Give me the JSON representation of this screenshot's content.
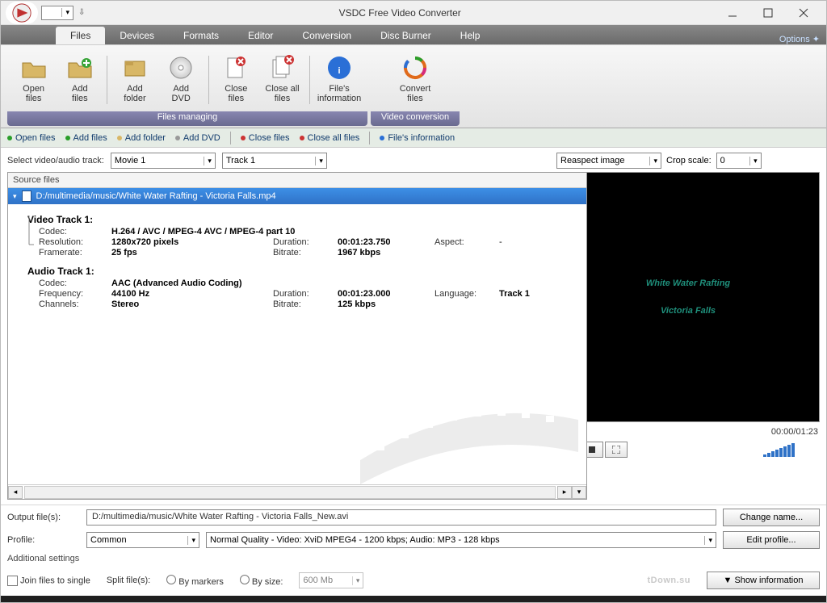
{
  "window": {
    "title": "VSDC Free Video Converter",
    "tabs": [
      "Files",
      "Devices",
      "Formats",
      "Editor",
      "Conversion",
      "Disc Burner",
      "Help"
    ],
    "active_tab": "Files",
    "options": "Options"
  },
  "ribbon": {
    "group1_label": "Files managing",
    "group2_label": "Video conversion",
    "buttons": {
      "open": "Open\nfiles",
      "add": "Add\nfiles",
      "add_folder": "Add\nfolder",
      "add_dvd": "Add\nDVD",
      "close": "Close\nfiles",
      "close_all": "Close all\nfiles",
      "info": "File's\ninformation",
      "convert": "Convert\nfiles"
    }
  },
  "toolbar2": {
    "open": "Open files",
    "add": "Add files",
    "add_folder": "Add folder",
    "add_dvd": "Add DVD",
    "close": "Close files",
    "close_all": "Close all files",
    "info": "File's information"
  },
  "selectors": {
    "label": "Select video/audio track:",
    "movie": "Movie 1",
    "track": "Track 1"
  },
  "source": {
    "panel_title": "Source files",
    "file_path": "D:/multimedia/music/White Water Rafting - Victoria Falls.mp4",
    "video_track_title": "Video Track 1:",
    "audio_track_title": "Audio Track 1:",
    "video": {
      "codec_k": "Codec:",
      "codec_v": "H.264 / AVC / MPEG-4 AVC / MPEG-4 part 10",
      "res_k": "Resolution:",
      "res_v": "1280x720 pixels",
      "dur_k": "Duration:",
      "dur_v": "00:01:23.750",
      "asp_k": "Aspect:",
      "asp_v": "-",
      "fr_k": "Framerate:",
      "fr_v": "25 fps",
      "br_k": "Bitrate:",
      "br_v": "1967 kbps"
    },
    "audio": {
      "codec_k": "Codec:",
      "codec_v": "AAC (Advanced Audio Coding)",
      "freq_k": "Frequency:",
      "freq_v": "44100 Hz",
      "dur_k": "Duration:",
      "dur_v": "00:01:23.000",
      "lang_k": "Language:",
      "lang_v": "Track 1",
      "ch_k": "Channels:",
      "ch_v": "Stereo",
      "br_k": "Bitrate:",
      "br_v": "125 kbps"
    }
  },
  "preview": {
    "mode_label": "Reaspect image",
    "crop_label": "Crop scale:",
    "crop_value": "0",
    "overlay_l1": "White Water Rafting",
    "overlay_l2": "Victoria Falls",
    "time": "00:00/01:23"
  },
  "output": {
    "label": "Output file(s):",
    "value": "D:/multimedia/music/White Water Rafting - Victoria Falls_New.avi",
    "change": "Change name..."
  },
  "profile": {
    "label": "Profile:",
    "cat": "Common",
    "desc": "Normal Quality - Video: XviD MPEG4 - 1200 kbps; Audio: MP3 - 128 kbps",
    "edit": "Edit profile..."
  },
  "additional": {
    "header": "Additional settings",
    "join": "Join files to single",
    "split": "Split file(s):",
    "by_markers": "By markers",
    "by_size": "By size:",
    "size_value": "600 Mb",
    "brand": "tDown.su",
    "show_info": "▼ Show information"
  }
}
